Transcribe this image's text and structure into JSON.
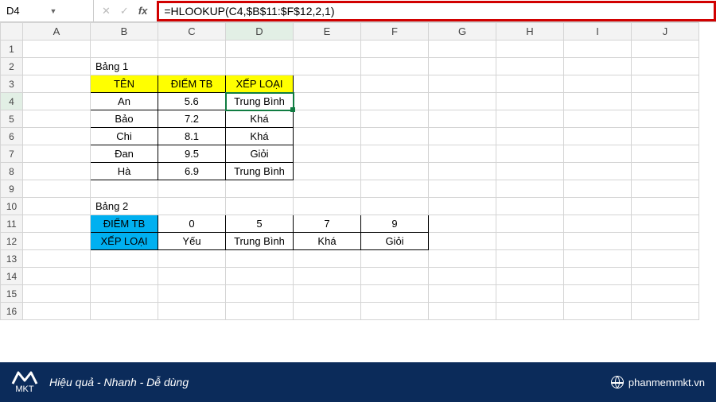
{
  "nameBox": "D4",
  "formula": "=HLOOKUP(C4,$B$11:$F$12,2,1)",
  "columns": [
    "A",
    "B",
    "C",
    "D",
    "E",
    "F",
    "G",
    "H",
    "I",
    "J"
  ],
  "rows": [
    "1",
    "2",
    "3",
    "4",
    "5",
    "6",
    "7",
    "8",
    "9",
    "10",
    "11",
    "12",
    "13",
    "14",
    "15",
    "16"
  ],
  "bang1": {
    "title": "Bảng 1",
    "headers": {
      "ten": "TÊN",
      "diem": "ĐIỂM TB",
      "xeploai": "XẾP LOẠI"
    },
    "data": [
      {
        "ten": "An",
        "diem": "5.6",
        "xeploai": "Trung Bình"
      },
      {
        "ten": "Bảo",
        "diem": "7.2",
        "xeploai": "Khá"
      },
      {
        "ten": "Chi",
        "diem": "8.1",
        "xeploai": "Khá"
      },
      {
        "ten": "Đan",
        "diem": "9.5",
        "xeploai": "Giỏi"
      },
      {
        "ten": "Hà",
        "diem": "6.9",
        "xeploai": "Trung Bình"
      }
    ]
  },
  "bang2": {
    "title": "Bảng 2",
    "rowLabels": {
      "diem": "ĐIỂM TB",
      "xeploai": "XẾP LOẠI"
    },
    "diem": [
      "0",
      "5",
      "7",
      "9"
    ],
    "xeploai": [
      "Yếu",
      "Trung Bình",
      "Khá",
      "Giỏi"
    ]
  },
  "footer": {
    "brandTop": "M",
    "brandBot": "MKT",
    "tagline": "Hiệu quả - Nhanh  - Dễ dùng",
    "site": "phanmemmkt.vn"
  }
}
